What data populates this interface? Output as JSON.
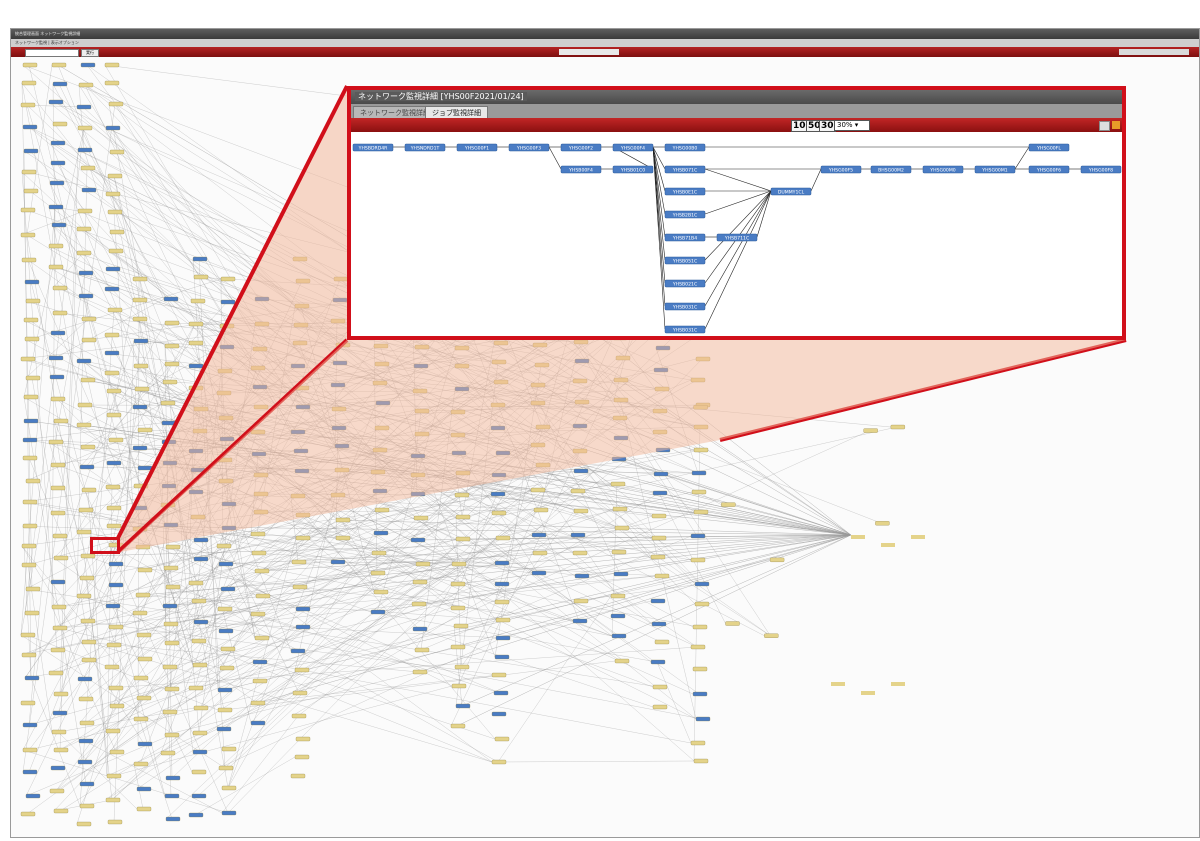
{
  "window": {
    "title": "統合管理画面 ネットワーク監視詳細",
    "menu": "ネットワーク監視 | 表示オプション"
  },
  "toolbar": {
    "button": "実行"
  },
  "zoom_panel": {
    "title": "ネットワーク監視詳細 [YHS00F2021/01/24]",
    "tabs": [
      "ネットワーク監視詳細",
      "ジョブ監視詳細"
    ],
    "zoom_buttons": [
      "100",
      "50",
      "30"
    ],
    "zoom_select": "30%"
  },
  "jobs": [
    {
      "label": "YHSBDRD4R"
    },
    {
      "label": "YHSNDRD1T"
    },
    {
      "label": "YHSG00F1"
    },
    {
      "label": "YHSG00F3"
    },
    {
      "label": "YHSG00F2"
    },
    {
      "label": "YHSG00F4"
    },
    {
      "label": "YHSG00B0"
    },
    {
      "label": "YHSB00F4"
    },
    {
      "label": "YHSB01C0"
    },
    {
      "label": "YHSB071C"
    },
    {
      "label": "YHSB0E1C"
    },
    {
      "label": "YHSB2B1C"
    },
    {
      "label": "YHSB71B4"
    },
    {
      "label": "YHSB711C"
    },
    {
      "label": "YHSB051C"
    },
    {
      "label": "YHSB021C"
    },
    {
      "label": "YHSB031C"
    },
    {
      "label": "YHSB031C"
    },
    {
      "label": "DUMMY1CL"
    },
    {
      "label": "YHSG00F5"
    },
    {
      "label": "BHSG00M2"
    },
    {
      "label": "YHSG00M0"
    },
    {
      "label": "YHSG00M1"
    },
    {
      "label": "YHSG00FL"
    },
    {
      "label": "YHSG00F6"
    },
    {
      "label": "YHSG00F8"
    }
  ],
  "colors": {
    "accent": "#d10f1a",
    "node_blue": "#4a7cc4",
    "node_yellow": "#e4d38a",
    "header_red": "#a81a1a"
  }
}
